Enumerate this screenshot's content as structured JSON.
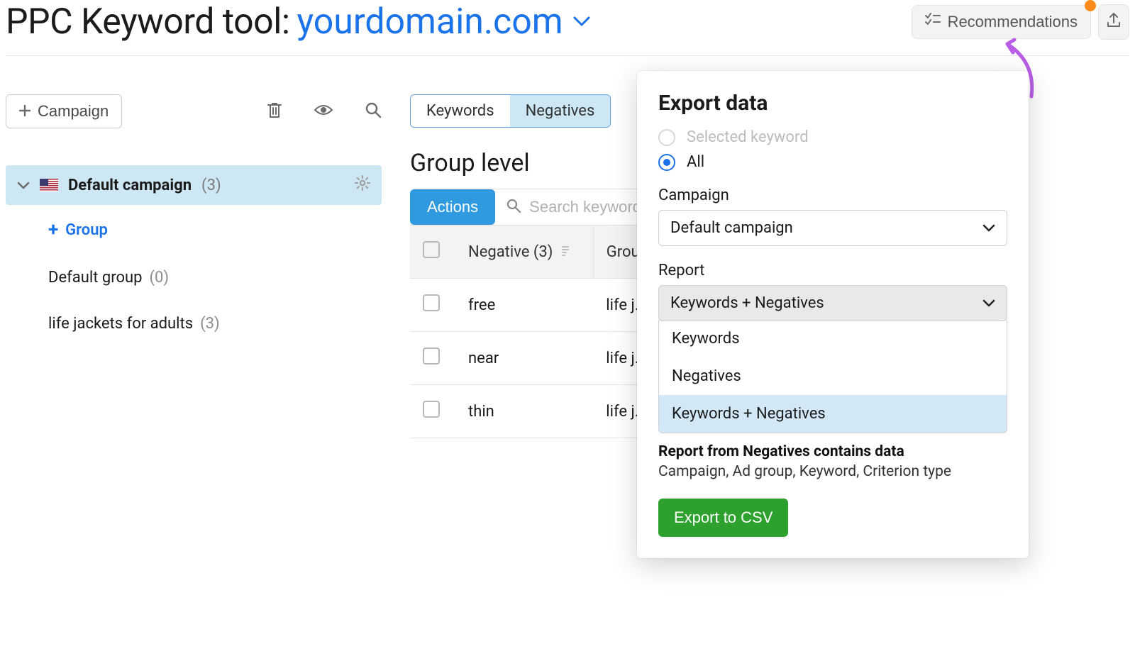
{
  "header": {
    "title": "PPC Keyword tool:",
    "domain": "yourdomain.com",
    "recommendations_label": "Recommendations"
  },
  "left": {
    "add_campaign_label": "Campaign",
    "icons": {
      "trash": "trash",
      "eye": "eye",
      "search": "search"
    },
    "campaign": {
      "name": "Default campaign",
      "count": "(3)"
    },
    "add_group_label": "Group",
    "groups": [
      {
        "name": "Default group",
        "count": "(0)"
      },
      {
        "name": "life jackets for adults",
        "count": "(3)"
      }
    ]
  },
  "right": {
    "tabs": {
      "keywords": "Keywords",
      "negatives": "Negatives"
    },
    "group_level_title": "Group level",
    "actions_label": "Actions",
    "search_placeholder": "Search keywords",
    "table": {
      "col_negative": "Negative (3)",
      "col_group": "Group",
      "rows": [
        {
          "neg": "free",
          "group": "life j."
        },
        {
          "neg": "near",
          "group": "life j."
        },
        {
          "neg": "thin",
          "group": "life j."
        }
      ]
    }
  },
  "export": {
    "title": "Export data",
    "radio_selected": "Selected keyword",
    "radio_all": "All",
    "campaign_label": "Campaign",
    "campaign_value": "Default campaign",
    "report_label": "Report",
    "report_value": "Keywords + Negatives",
    "options": {
      "keywords": "Keywords",
      "negatives": "Negatives",
      "both": "Keywords + Negatives"
    },
    "hint_bold": "Report from Negatives contains data",
    "hint": "Campaign, Ad group, Keyword, Criterion type",
    "button": "Export to CSV"
  }
}
